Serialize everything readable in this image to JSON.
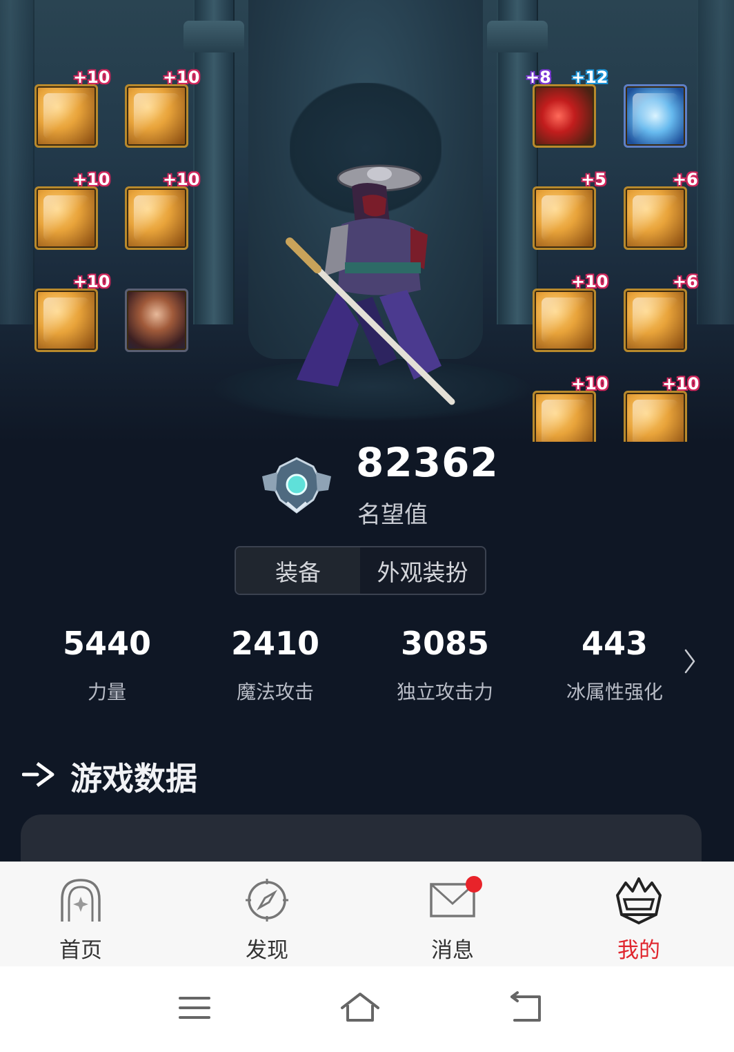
{
  "equipment": {
    "left_slots": [
      {
        "name": "shoulder",
        "level": "+10"
      },
      {
        "name": "top",
        "level": "+10"
      },
      {
        "name": "bottom",
        "level": "+10"
      },
      {
        "name": "belt",
        "level": "+10"
      },
      {
        "name": "shoes",
        "level": "+10"
      },
      {
        "name": "pet",
        "level": ""
      }
    ],
    "right_slots": [
      {
        "name": "weapon",
        "level": "+8",
        "level2": "+12"
      },
      {
        "name": "title",
        "level": ""
      },
      {
        "name": "bracelet",
        "level": "+5"
      },
      {
        "name": "necklace",
        "level": "+6"
      },
      {
        "name": "gloves",
        "level": "+10"
      },
      {
        "name": "ring",
        "level": "+6"
      },
      {
        "name": "support",
        "level": "+10"
      },
      {
        "name": "earring",
        "level": "+10"
      }
    ]
  },
  "prestige": {
    "value": "82362",
    "label": "名望值"
  },
  "toggle": {
    "equip": "装备",
    "avatar": "外观装扮"
  },
  "stats": [
    {
      "value": "5440",
      "label": "力量"
    },
    {
      "value": "2410",
      "label": "魔法攻击"
    },
    {
      "value": "3085",
      "label": "独立攻击力"
    },
    {
      "value": "443",
      "label": "冰属性强化"
    }
  ],
  "game_data": {
    "title": "游戏数据"
  },
  "tabbar": {
    "home": "首页",
    "discover": "发现",
    "messages": "消息",
    "mine": "我的",
    "active_color": "#e0262e"
  },
  "icons": [
    "arch-home-icon",
    "compass-icon",
    "mail-icon",
    "crown-icon",
    "menu-icon",
    "home-icon",
    "back-icon",
    "chevron-right-icon"
  ]
}
